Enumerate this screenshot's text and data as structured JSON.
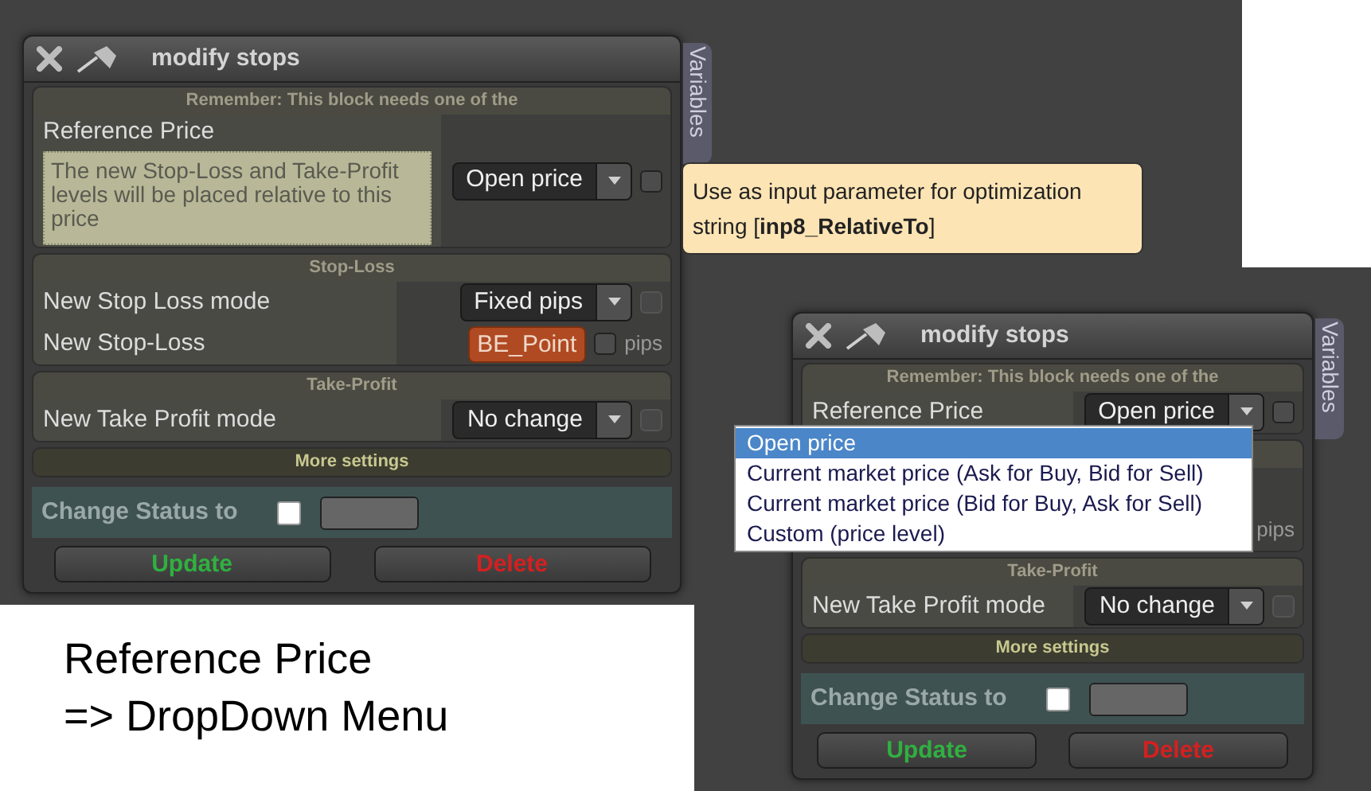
{
  "dialogs": [
    {
      "title": "modify stops",
      "side_tab": "Variables",
      "notice": "Remember: This block needs one of the",
      "sections": [
        {
          "kind": "reference",
          "rows": [
            {
              "label": "Reference Price",
              "description": "The new Stop-Loss and Take-Profit levels will be placed relative to this price",
              "control": {
                "kind": "select",
                "value": "Open price"
              },
              "checkbox": {
                "checked": false,
                "disabled": false
              }
            }
          ]
        },
        {
          "kind": "stop_loss",
          "header": "Stop-Loss",
          "rows": [
            {
              "label": "New Stop Loss mode",
              "control": {
                "kind": "select",
                "value": "Fixed pips"
              },
              "checkbox": {
                "checked": false,
                "disabled": true
              }
            },
            {
              "label": "New Stop-Loss",
              "control": {
                "kind": "button",
                "value": "BE_Point"
              },
              "checkbox": {
                "checked": false,
                "disabled": false
              },
              "suffix": "pips"
            }
          ]
        },
        {
          "kind": "take_profit",
          "header": "Take-Profit",
          "rows": [
            {
              "label": "New Take Profit mode",
              "control": {
                "kind": "select",
                "value": "No change"
              },
              "checkbox": {
                "checked": false,
                "disabled": true
              }
            }
          ]
        },
        {
          "kind": "more",
          "header": "More settings"
        }
      ],
      "status": {
        "label": "Change Status to",
        "checked": false
      },
      "buttons": [
        {
          "label": "Update",
          "kind": "confirm"
        },
        {
          "label": "Delete",
          "kind": "danger"
        }
      ]
    },
    {
      "title": "modify stops",
      "side_tab": "Variables",
      "notice": "Remember: This block needs one of the",
      "sections": [
        {
          "kind": "reference",
          "rows": [
            {
              "label": "Reference Price",
              "control": {
                "kind": "select",
                "value": "Open price"
              },
              "checkbox": {
                "checked": false,
                "disabled": false
              }
            }
          ]
        },
        {
          "kind": "stop_loss",
          "rows": [
            {},
            {
              "suffix": "pips"
            }
          ]
        },
        {
          "kind": "take_profit",
          "header": "Take-Profit",
          "rows": [
            {
              "label": "New Take Profit mode",
              "control": {
                "kind": "select",
                "value": "No change"
              },
              "checkbox": {
                "checked": false,
                "disabled": true
              }
            }
          ]
        },
        {
          "kind": "more",
          "header": "More settings"
        }
      ],
      "status": {
        "label": "Change Status to",
        "checked": false
      },
      "buttons": [
        {
          "label": "Update",
          "kind": "confirm"
        },
        {
          "label": "Delete",
          "kind": "danger"
        }
      ],
      "dropdown": {
        "options": [
          {
            "label": "Open price",
            "selected": true
          },
          {
            "label": "Current market price (Ask for Buy, Bid for Sell)",
            "selected": false
          },
          {
            "label": "Current market price (Bid for Buy, Ask for Sell)",
            "selected": false
          },
          {
            "label": "Custom (price level)",
            "selected": false
          }
        ]
      }
    }
  ],
  "tooltip": {
    "text": "Use as input parameter for optimization string [**inp8_RelativeTo**]"
  },
  "caption": {
    "lines": [
      "Reference Price",
      "=> DropDown Menu"
    ]
  }
}
